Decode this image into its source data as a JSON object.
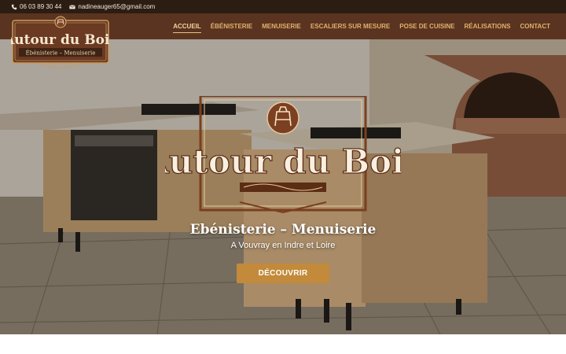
{
  "topbar": {
    "phone": "06 03 89 30 44",
    "email": "nadineauger65@gmail.com",
    "phone_icon": "phone-icon",
    "email_icon": "envelope-icon"
  },
  "logo": {
    "title": "Autour du Bois",
    "subtitle": "Ébénisterie – Menuiserie"
  },
  "nav": {
    "items": [
      {
        "label": "Accueil",
        "active": true
      },
      {
        "label": "Ébénisterie",
        "active": false
      },
      {
        "label": "Menuiserie",
        "active": false
      },
      {
        "label": "Escaliers sur mesure",
        "active": false
      },
      {
        "label": "Pose de cuisine",
        "active": false
      },
      {
        "label": "Réalisations",
        "active": false
      },
      {
        "label": "Contact",
        "active": false
      }
    ]
  },
  "hero": {
    "logo_title": "Autour du Bois",
    "subtitle": "Ebénisterie – Menuiserie",
    "location": "A Vouvray en Indre et Loire",
    "cta_label": "Découvrir"
  },
  "colors": {
    "topbar_bg": "#2b1d12",
    "header_bg": "#5a3420",
    "nav_text": "#e2b06d",
    "cta_bg": "#c28a3a"
  }
}
